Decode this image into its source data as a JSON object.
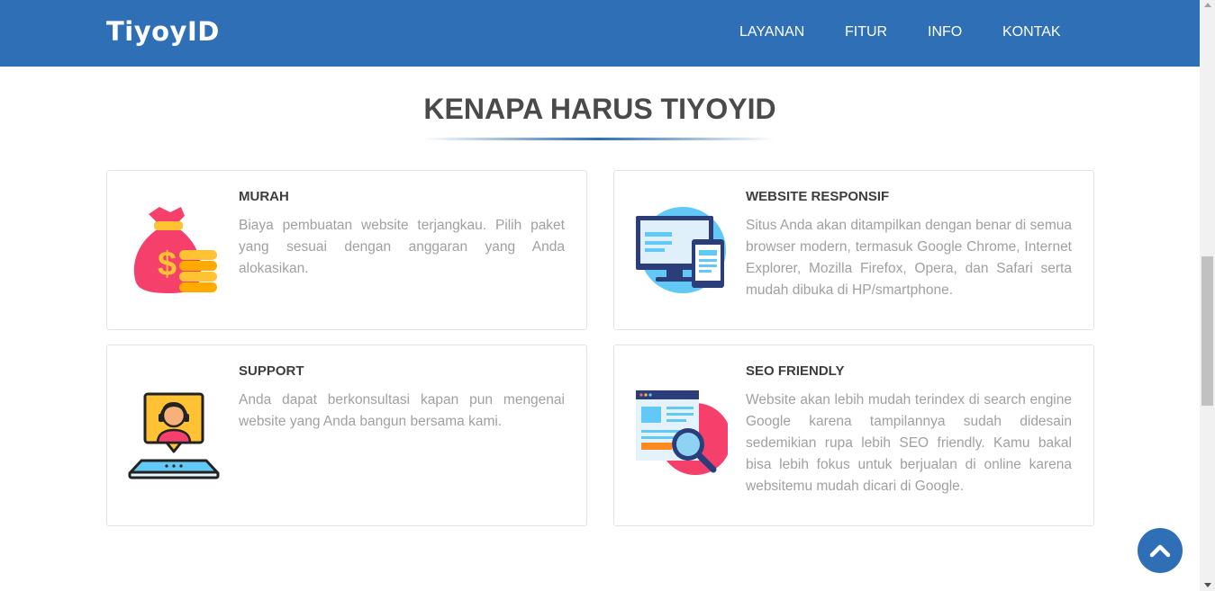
{
  "header": {
    "brand": "TiyoyID",
    "nav": [
      {
        "label": "LAYANAN"
      },
      {
        "label": "FITUR"
      },
      {
        "label": "INFO"
      },
      {
        "label": "KONTAK"
      }
    ]
  },
  "section": {
    "title": "KENAPA HARUS TIYOYID"
  },
  "features": [
    {
      "title": "MURAH",
      "text": "Biaya pembuatan website terjangkau. Pilih paket yang sesuai dengan anggaran yang Anda alokasikan.",
      "icon": "money-bag-icon"
    },
    {
      "title": "WEBSITE RESPONSIF",
      "text": "Situs Anda akan ditampilkan dengan benar di semua browser modern, termasuk Google Chrome, Internet Explorer, Mozilla Firefox, Opera, dan Safari serta mudah dibuka di HP/smartphone.",
      "icon": "responsive-devices-icon"
    },
    {
      "title": "SUPPORT",
      "text": "Anda dapat berkonsultasi kapan pun mengenai website yang Anda bangun bersama kami.",
      "icon": "support-agent-icon"
    },
    {
      "title": "SEO FRIENDLY",
      "text": "Website akan lebih mudah terindex di search engine Google karena tampilannya sudah didesain sedemikian rupa lebih SEO friendly. Kamu bakal bisa lebih fokus untuk berjualan di online karena websitemu mudah dicari di Google.",
      "icon": "seo-search-icon"
    }
  ],
  "back_to_top": {
    "icon": "chevron-up-icon"
  },
  "colors": {
    "primary": "#2e6fb5",
    "heading": "#4a4a4a",
    "body_text": "#a0a0a0"
  }
}
